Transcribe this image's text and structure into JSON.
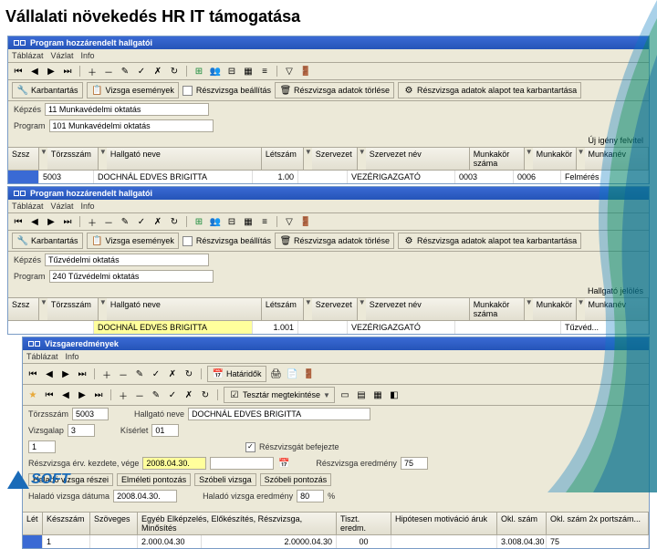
{
  "title": "Vállalati növekedés HR IT támogatása",
  "win1": {
    "title": "Program hozzárendelt hallgatói",
    "tab1": "Táblázat",
    "tab2": "Vázlat",
    "tab3": "Info",
    "tb_kar": "Karbantartás",
    "tb_vizsga": "Vizsga események",
    "tb_resz": "Részvizsga beállítás",
    "tb_reszad": "Részvizsga adatok törlése",
    "tb_reszal": "Részvizsga adatok alapot tea karbantartása",
    "lbl_kepzes": "Képzés",
    "val_kepzes": "11 Munkavédelmi oktatás",
    "lbl_prog": "Program",
    "val_prog": "101 Munkavédelmi oktatás",
    "rt": "Új igény felvitel",
    "h_szsz": "Szsz",
    "h_torzs": "Törzsszám",
    "h_nev": "Hallgató neve",
    "h_letsz": "Létszám",
    "h_szervezet": "Szervezet",
    "h_szervnev": "Szervezet név",
    "h_munkakor": "Munkakör száma",
    "h_munkakor2": "Munkakör",
    "h_munkanev": "Munkanév",
    "r_torzs": "5003",
    "r_nev": "DOCHNÁL EDVES BRIGITTA",
    "r_letsz": "1.00",
    "r_szervnev": "VEZÉRIGAZGATÓ",
    "r_mk": "0003",
    "r_mk2": "0006",
    "r_mn": "Felmérés"
  },
  "win2": {
    "title": "Program hozzárendelt hallgatói",
    "tab1": "Táblázat",
    "tab2": "Vázlat",
    "tab3": "Info",
    "tb_kar": "Karbantartás",
    "tb_vizsga": "Vizsga események",
    "tb_resz": "Részvizsga beállítás",
    "tb_reszad": "Részvizsga adatok törlése",
    "tb_reszal": "Részvizsga adatok alapot tea karbantartása",
    "lbl_kepzes": "Képzés",
    "val_kepzes": "Tűzvédelmi oktatás",
    "lbl_prog": "Program",
    "val_prog": "240 Tűzvédelmi oktatás",
    "rt": "Hallgató jelölés",
    "h_szsz": "Szsz",
    "h_torzs": "Törzsszám",
    "h_nev": "Hallgató neve",
    "h_letsz": "Létszám",
    "h_szervezet": "Szervezet",
    "h_szervnev": "Szervezet név",
    "h_munkakor": "Munkakör száma",
    "h_munkakor2": "Munkakör",
    "h_munkanev": "Munkanév",
    "r_nev": "DOCHNÁL EDVES BRIGITTA",
    "r_letsz": "1.001",
    "r_szervnev": "VEZÉRIGAZGATÓ",
    "r_mn": "Tűzvéd..."
  },
  "win3": {
    "title": "Vizsgaeredmények",
    "tab1": "Táblázat",
    "tab2": "Info",
    "tb_hatr": "Határidők",
    "tb_tesz": "Tesztár megtekintése",
    "lbl_torzs": "Törzsszám",
    "val_torzs": "5003",
    "lbl_hnev": "Hallgató neve",
    "val_hnev": "DOCHNÁL EDVES BRIGITTA",
    "lbl_vizsga": "Vizsgalap",
    "val_vizsga": "3",
    "lbl_kis": "Kísérlet",
    "val_kis": "01",
    "lbl_reszvb": "Részvizsgát befejezte",
    "lbl_reszker": "Részvizsga érv. kezdete, vége",
    "val_resz1": "2008.04.30.",
    "lbl_reszer": "Részvizsga eredmény",
    "val_reszer": "75",
    "lbl_hal1": "Haladó vizsga részei",
    "lbl_hal2": "Elméleti pontozás",
    "lbl_hal3": "Szóbeli vizsga",
    "lbl_hal4": "Szóbeli pontozás",
    "lbl_hdat": "Haladó vizsga dátuma",
    "val_hdat": "2008.04.30.",
    "lbl_her": "Haladó vizsga eredmény",
    "val_her": "80",
    "val_her2": "%"
  },
  "foot": {
    "h1": "Lét",
    "h2": "Készszám",
    "h3": "Szöveges",
    "h4": "Egyéb Elképzelés, Előkészítés, Részvizsga, Minősítés",
    "h5": "Tiszt. eredm.",
    "h6": "Hipótesen motiváció áruk",
    "h7": "Okl. szám",
    "h8": "Okl. szám 2x portszám...",
    "v1": "1",
    "v2": "2.000.04.30",
    "v3": "2.0000.04.30",
    "v4": "00",
    "v5": "3.008.04.30",
    "v6": "75"
  },
  "logo": "SOFT"
}
